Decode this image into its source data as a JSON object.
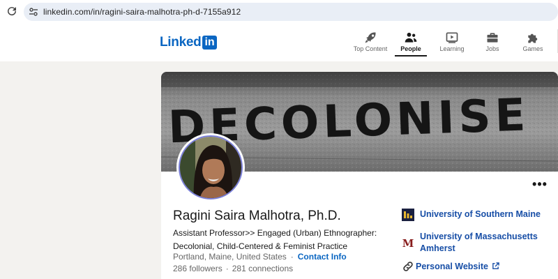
{
  "browser": {
    "url": "linkedin.com/in/ragini-saira-malhotra-ph-d-7155a912"
  },
  "header": {
    "logo_text": "Linked",
    "logo_in": "in",
    "nav": [
      {
        "label": "Top Content",
        "icon": "rocket-icon"
      },
      {
        "label": "People",
        "icon": "people-icon",
        "active": true
      },
      {
        "label": "Learning",
        "icon": "play-icon"
      },
      {
        "label": "Jobs",
        "icon": "briefcase-icon"
      },
      {
        "label": "Games",
        "icon": "puzzle-icon"
      }
    ]
  },
  "profile": {
    "name": "Ragini Saira Malhotra, Ph.D.",
    "headline": "Assistant Professor>> Engaged (Urban) Ethnographer: Decolonial, Child-Centered & Feminist Practice",
    "location": "Portland, Maine, United States",
    "contact_label": "Contact Info",
    "followers": "286 followers",
    "connections": "281 connections",
    "more_label": "•••",
    "banner_text": "DECOLONISE"
  },
  "affiliations": [
    {
      "label": "University of Southern Maine",
      "icon": "usm-logo"
    },
    {
      "label": "University of Massachusetts Amherst",
      "line1": "University of Massachusetts",
      "line2": "Amherst",
      "icon": "umass-logo"
    },
    {
      "label": "Personal Website",
      "icon": "link-icon"
    }
  ],
  "colors": {
    "linkedin_blue": "#0a66c2",
    "link_blue": "#174ea6",
    "page_bg": "#f3f2ef"
  }
}
